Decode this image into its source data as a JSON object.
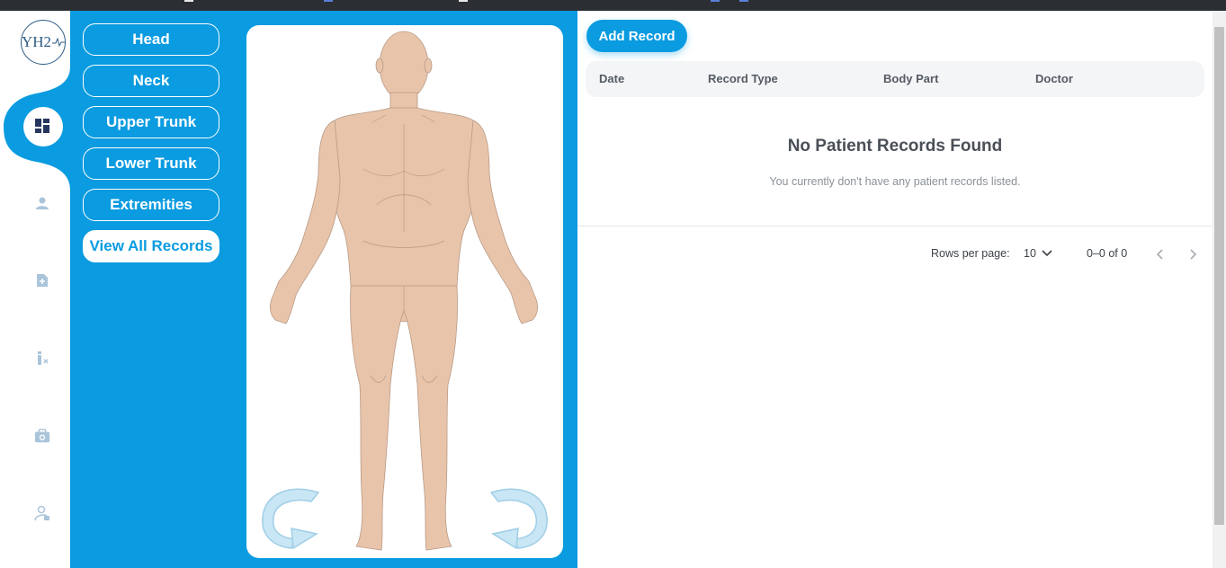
{
  "logo": {
    "text": "YH2"
  },
  "rail_icons": [
    "dashboard-icon",
    "person-icon",
    "add-document-icon",
    "medication-icon",
    "medical-kit-icon",
    "lock-person-icon"
  ],
  "body_nav": {
    "items": [
      "Head",
      "Neck",
      "Upper Trunk",
      "Lower Trunk",
      "Extremities"
    ],
    "view_all": "View All Records"
  },
  "records": {
    "add_button": "Add Record",
    "columns": [
      "Date",
      "Record Type",
      "Body Part",
      "Doctor"
    ],
    "empty_title": "No Patient Records Found",
    "empty_subtitle": "You currently don't have any patient records listed.",
    "pagination": {
      "rows_label": "Rows per page:",
      "rows_value": "10",
      "range": "0–0 of 0"
    }
  },
  "colors": {
    "accent": "#0a9be0",
    "skin": "#e8c4aa",
    "rail_icon": "#aac4da"
  }
}
